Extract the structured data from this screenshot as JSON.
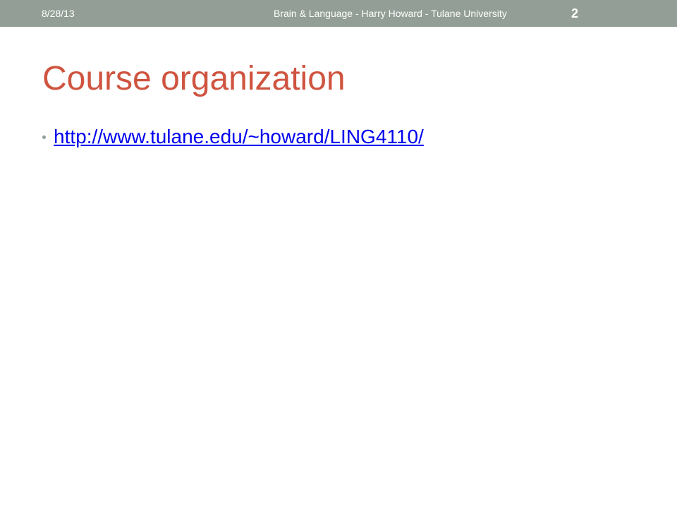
{
  "header": {
    "date": "8/28/13",
    "footer_text": "Brain & Language - Harry Howard - Tulane University",
    "slide_number": "2"
  },
  "slide": {
    "title": "Course organization",
    "bullets": [
      {
        "text": "http://www.tulane.edu/~howard/LING4110/",
        "is_link": true
      }
    ]
  },
  "colors": {
    "header_bar": "#939e96",
    "title": "#cf543f",
    "link": "#0000ee",
    "bullet": "#939e96"
  }
}
